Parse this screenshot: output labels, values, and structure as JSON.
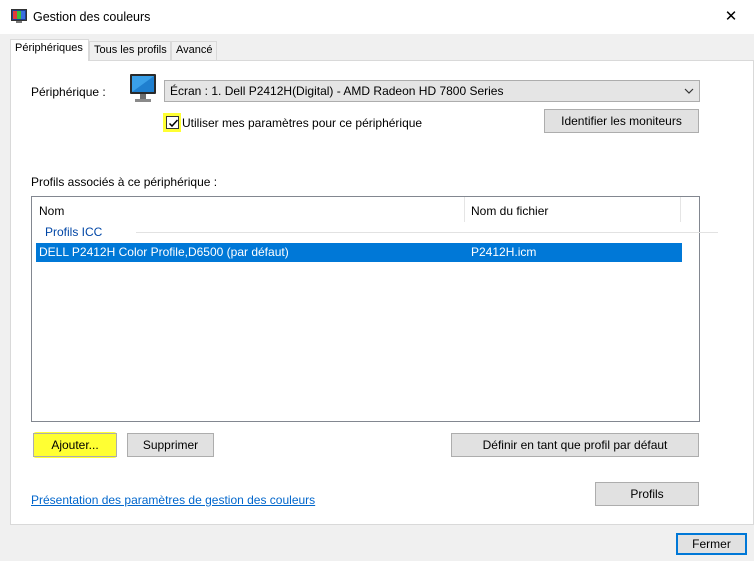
{
  "window": {
    "title": "Gestion des couleurs",
    "app_icon": "color-management-icon",
    "close_glyph": "✕"
  },
  "tabs": [
    {
      "label": "Périphériques",
      "active": true
    },
    {
      "label": "Tous les profils",
      "active": false
    },
    {
      "label": "Avancé",
      "active": false
    }
  ],
  "device": {
    "label": "Périphérique :",
    "icon": "monitor-icon",
    "selected": "Écran : 1. Dell P2412H(Digital) - AMD Radeon HD 7800 Series",
    "use_settings_label": "Utiliser mes paramètres pour ce périphérique",
    "use_settings_checked": true,
    "identify_button": "Identifier les moniteurs"
  },
  "profiles": {
    "section_label": "Profils associés à ce périphérique :",
    "columns": [
      "Nom",
      "Nom du fichier"
    ],
    "group": "Profils ICC",
    "rows": [
      {
        "name": "DELL P2412H Color Profile,D6500 (par défaut)",
        "file": "P2412H.icm",
        "selected": true
      }
    ]
  },
  "buttons": {
    "add": "Ajouter...",
    "remove": "Supprimer",
    "set_default": "Définir en tant que profil par défaut",
    "profiles": "Profils",
    "close": "Fermer"
  },
  "link": "Présentation des paramètres de gestion des couleurs",
  "colors": {
    "selection": "#0078d7",
    "highlight": "#ffff33",
    "link": "#0066cc"
  }
}
